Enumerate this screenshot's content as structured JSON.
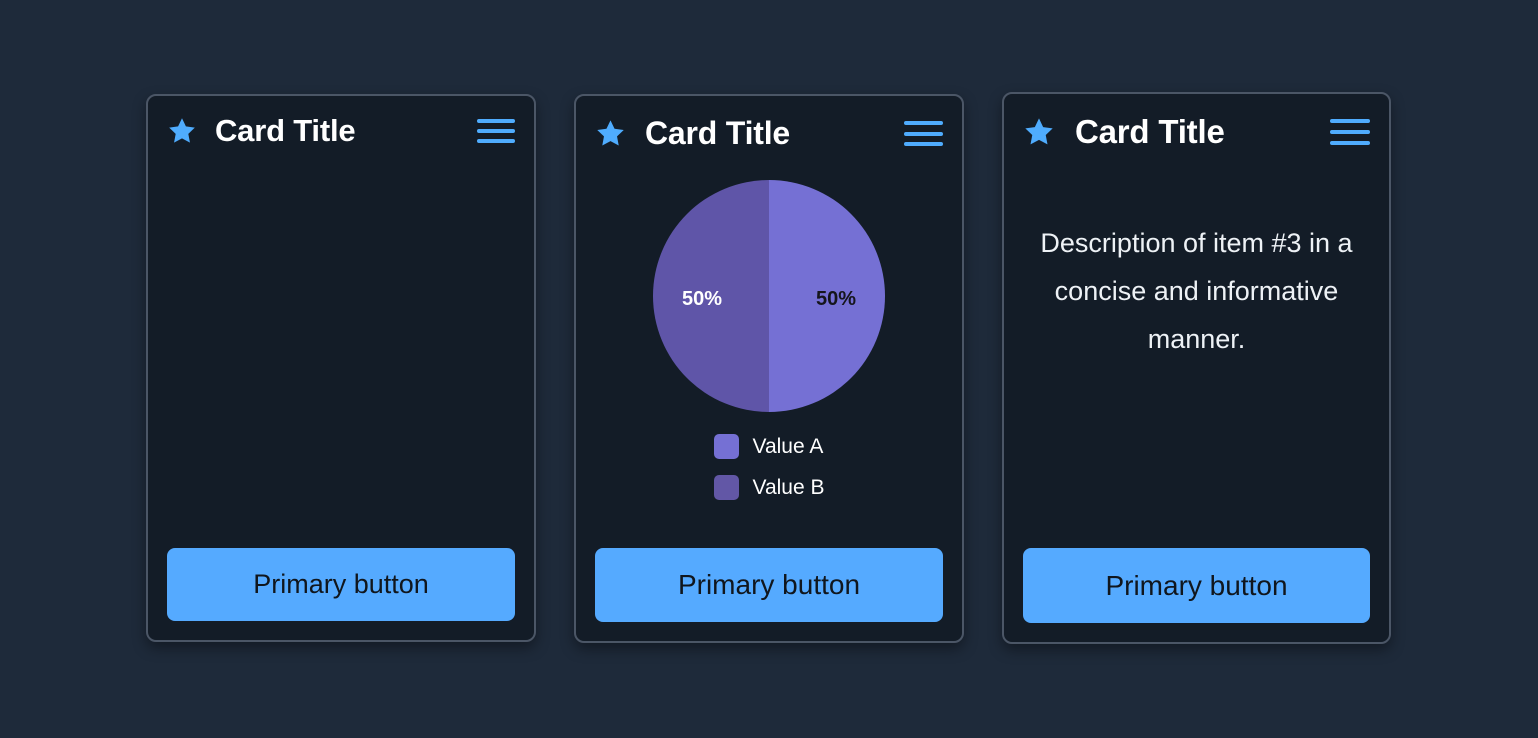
{
  "page": {
    "background_color": "#1e2a3a",
    "card_background_color": "#131c27",
    "card_border_color": "#4b5666",
    "accent_color": "#4facfe",
    "button_color": "#55aaff"
  },
  "cards": [
    {
      "title": "Card Title",
      "star_icon": "star-icon",
      "menu_icon": "hamburger-menu-icon",
      "button_label": "Primary button"
    },
    {
      "title": "Card Title",
      "star_icon": "star-icon",
      "menu_icon": "hamburger-menu-icon",
      "button_label": "Primary button",
      "chart_labels": {
        "left": "50%",
        "right": "50%"
      },
      "legend": [
        {
          "label": "Value A",
          "color": "#7570d4"
        },
        {
          "label": "Value B",
          "color": "#5f55a8"
        }
      ]
    },
    {
      "title": "Card Title",
      "star_icon": "star-icon",
      "menu_icon": "hamburger-menu-icon",
      "description": "Description of item #3 in a concise and informative manner.",
      "button_label": "Primary button"
    }
  ],
  "chart_data": {
    "type": "pie",
    "title": "",
    "categories": [
      "Value A",
      "Value B"
    ],
    "values": [
      50,
      50
    ],
    "data_labels": [
      "50%",
      "50%"
    ],
    "colors": [
      "#7570d4",
      "#5f55a8"
    ],
    "legend_position": "bottom",
    "units": "percent"
  }
}
